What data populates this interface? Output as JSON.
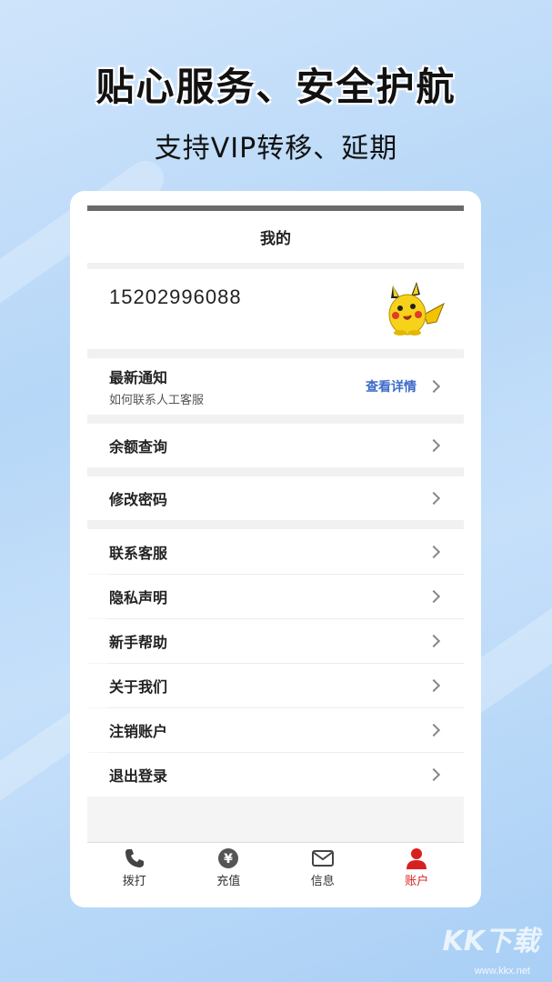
{
  "promo": {
    "headline": "贴心服务、安全护航",
    "subline": "支持VIP转移、延期"
  },
  "header": {
    "title": "我的"
  },
  "profile": {
    "phone_number": "15202996088",
    "avatar": "pikachu-avatar"
  },
  "notice": {
    "title": "最新通知",
    "subtitle": "如何联系人工客服",
    "link": "查看详情"
  },
  "menu": {
    "balance": "余额查询",
    "password": "修改密码",
    "items": [
      "联系客服",
      "隐私声明",
      "新手帮助",
      "关于我们",
      "注销账户",
      "退出登录"
    ]
  },
  "tabs": [
    {
      "label": "拨打",
      "icon": "phone-icon"
    },
    {
      "label": "充值",
      "icon": "yuan-icon"
    },
    {
      "label": "信息",
      "icon": "mail-icon"
    },
    {
      "label": "账户",
      "icon": "user-icon",
      "active": true
    }
  ],
  "colors": {
    "accent": "#d92020",
    "link": "#3d6bc7"
  },
  "watermark": {
    "text": "KK下载",
    "url": "www.kkx.net"
  }
}
